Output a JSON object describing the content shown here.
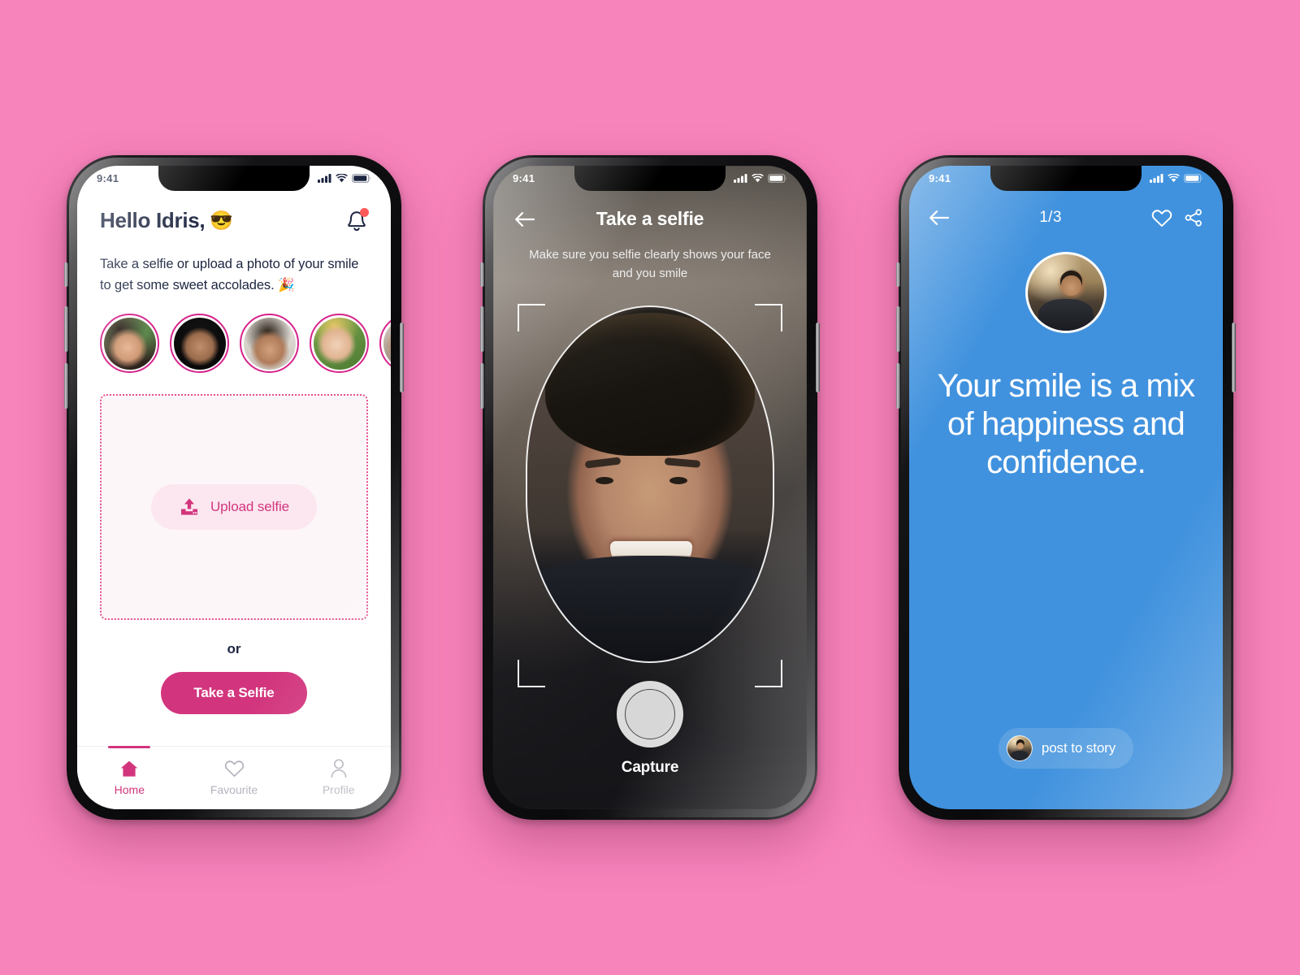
{
  "theme": {
    "background_pink": "#F884BC",
    "brand_pink": "#D2357D",
    "ring_pink": "#D6238C",
    "navy": "#1C2541",
    "result_blue": "#4192DE",
    "notification_red": "#FF5A5A"
  },
  "phone_home": {
    "status": {
      "time": "9:41",
      "signal_icon": "signal-icon",
      "wifi_icon": "wifi-icon",
      "battery_icon": "battery-icon"
    },
    "greeting": "Hello Idris,",
    "greeting_emoji": "😎",
    "bell_icon": "notification-bell-icon",
    "subtext": "Take a selfie or upload a photo of your smile to get some sweet accolades. 🎉",
    "stories": [
      {
        "name": "story-avatar-1"
      },
      {
        "name": "story-avatar-2"
      },
      {
        "name": "story-avatar-3"
      },
      {
        "name": "story-avatar-4"
      },
      {
        "name": "story-avatar-5"
      }
    ],
    "upload": {
      "icon": "upload-icon",
      "label": "Upload selfie"
    },
    "or_label": "or",
    "cta_label": "Take a Selfie",
    "tabs": [
      {
        "label": "Home",
        "icon": "home-icon",
        "active": true
      },
      {
        "label": "Favourite",
        "icon": "heart-icon",
        "active": false
      },
      {
        "label": "Profile",
        "icon": "person-icon",
        "active": false
      }
    ]
  },
  "phone_camera": {
    "status": {
      "time": "9:41"
    },
    "back_icon": "arrow-left-icon",
    "title": "Take a selfie",
    "subtitle": "Make sure you selfie clearly shows your face and you smile",
    "shutter_icon": "shutter-button",
    "capture_label": "Capture"
  },
  "phone_result": {
    "status": {
      "time": "9:41"
    },
    "back_icon": "arrow-left-icon",
    "counter": "1/3",
    "favourite_icon": "heart-icon",
    "share_icon": "share-icon",
    "avatar": "result-avatar",
    "quote": "Your smile is a mix of happiness and confidence.",
    "post_button": {
      "label": "post to story",
      "avatar": "post-avatar"
    }
  }
}
